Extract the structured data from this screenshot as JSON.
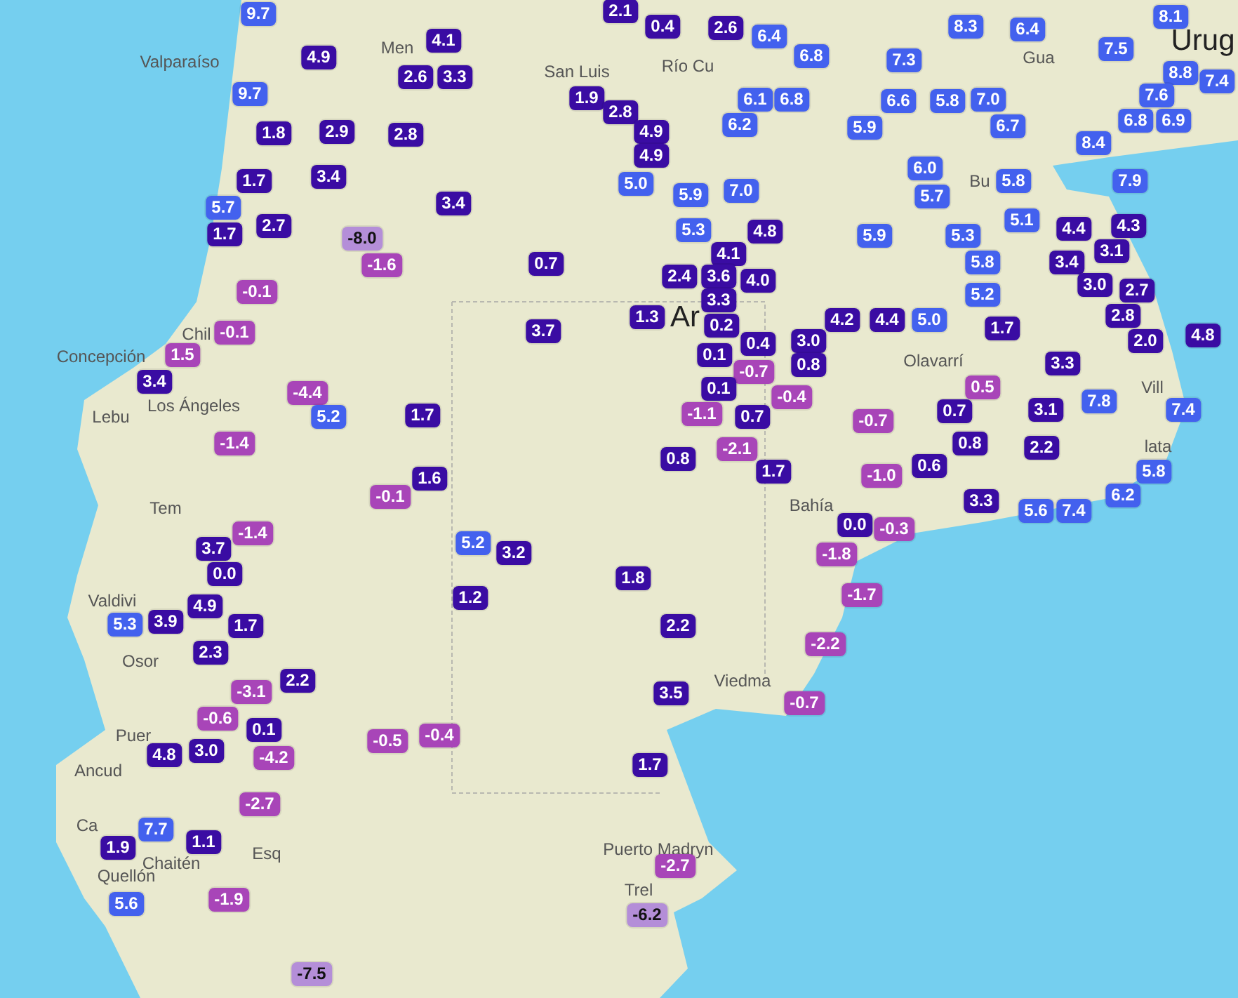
{
  "map": {
    "place_labels": [
      {
        "text": "Valparaíso",
        "kind": "city"
      },
      {
        "text": "Men",
        "kind": "city"
      },
      {
        "text": "San Luis",
        "kind": "city"
      },
      {
        "text": "Río Cu",
        "kind": "city"
      },
      {
        "text": "Gua",
        "kind": "city"
      },
      {
        "text": "Urug",
        "kind": "country"
      },
      {
        "text": "Chil",
        "kind": "city"
      },
      {
        "text": "Concepción",
        "kind": "city"
      },
      {
        "text": "Los Ángeles",
        "kind": "city"
      },
      {
        "text": "Lebu",
        "kind": "city"
      },
      {
        "text": "Ar",
        "kind": "country"
      },
      {
        "text": "Bu",
        "kind": "city"
      },
      {
        "text": "Olavarrí",
        "kind": "city"
      },
      {
        "text": "Vill",
        "kind": "city"
      },
      {
        "text": "lata",
        "kind": "city"
      },
      {
        "text": "Tem",
        "kind": "city"
      },
      {
        "text": "Bahía",
        "kind": "city"
      },
      {
        "text": "Valdivi",
        "kind": "city"
      },
      {
        "text": "Osor",
        "kind": "city"
      },
      {
        "text": "Viedma",
        "kind": "city"
      },
      {
        "text": "Puer",
        "kind": "city"
      },
      {
        "text": "Ancud",
        "kind": "city"
      },
      {
        "text": "Ca",
        "kind": "city"
      },
      {
        "text": "Esq",
        "kind": "city"
      },
      {
        "text": "Puerto Madryn",
        "kind": "city"
      },
      {
        "text": "Chaitén",
        "kind": "city"
      },
      {
        "text": "Quellón",
        "kind": "city"
      },
      {
        "text": "Trel",
        "kind": "city"
      }
    ],
    "markers": [
      {
        "value": "9.7",
        "color": "#4361ee"
      },
      {
        "value": "4.9",
        "color": "#3a0ca3"
      },
      {
        "value": "9.7",
        "color": "#4361ee"
      },
      {
        "value": "1.8",
        "color": "#3a0ca3"
      },
      {
        "value": "2.9",
        "color": "#3a0ca3"
      },
      {
        "value": "1.7",
        "color": "#3a0ca3"
      },
      {
        "value": "3.4",
        "color": "#3a0ca3"
      },
      {
        "value": "5.7",
        "color": "#4361ee"
      },
      {
        "value": "1.7",
        "color": "#3a0ca3"
      },
      {
        "value": "2.7",
        "color": "#3a0ca3"
      },
      {
        "value": "-8.0",
        "color": "#b48ed8"
      },
      {
        "value": "-1.6",
        "color": "#a845b8"
      },
      {
        "value": "-0.1",
        "color": "#a845b8"
      },
      {
        "value": "-0.1",
        "color": "#a845b8"
      },
      {
        "value": "1.5",
        "color": "#a845b8"
      },
      {
        "value": "3.4",
        "color": "#3a0ca3"
      },
      {
        "value": "-4.4",
        "color": "#a845b8"
      },
      {
        "value": "5.2",
        "color": "#4361ee"
      },
      {
        "value": "-1.4",
        "color": "#a845b8"
      },
      {
        "value": "1.7",
        "color": "#3a0ca3"
      },
      {
        "value": "-0.1",
        "color": "#a845b8"
      },
      {
        "value": "1.6",
        "color": "#3a0ca3"
      },
      {
        "value": "-1.4",
        "color": "#a845b8"
      },
      {
        "value": "3.7",
        "color": "#3a0ca3"
      },
      {
        "value": "0.0",
        "color": "#3a0ca3"
      },
      {
        "value": "4.9",
        "color": "#3a0ca3"
      },
      {
        "value": "5.3",
        "color": "#4361ee"
      },
      {
        "value": "3.9",
        "color": "#3a0ca3"
      },
      {
        "value": "1.7",
        "color": "#3a0ca3"
      },
      {
        "value": "2.3",
        "color": "#3a0ca3"
      },
      {
        "value": "2.2",
        "color": "#3a0ca3"
      },
      {
        "value": "-3.1",
        "color": "#a845b8"
      },
      {
        "value": "-0.6",
        "color": "#a845b8"
      },
      {
        "value": "0.1",
        "color": "#3a0ca3"
      },
      {
        "value": "-0.5",
        "color": "#a845b8"
      },
      {
        "value": "-0.4",
        "color": "#a845b8"
      },
      {
        "value": "4.8",
        "color": "#3a0ca3"
      },
      {
        "value": "3.0",
        "color": "#3a0ca3"
      },
      {
        "value": "-4.2",
        "color": "#a845b8"
      },
      {
        "value": "-2.7",
        "color": "#a845b8"
      },
      {
        "value": "7.7",
        "color": "#4361ee"
      },
      {
        "value": "1.1",
        "color": "#3a0ca3"
      },
      {
        "value": "1.9",
        "color": "#3a0ca3"
      },
      {
        "value": "5.6",
        "color": "#4361ee"
      },
      {
        "value": "-1.9",
        "color": "#a845b8"
      },
      {
        "value": "-7.5",
        "color": "#b48ed8"
      },
      {
        "value": "2.1",
        "color": "#3a0ca3"
      },
      {
        "value": "0.4",
        "color": "#3a0ca3"
      },
      {
        "value": "2.6",
        "color": "#3a0ca3"
      },
      {
        "value": "4.1",
        "color": "#3a0ca3"
      },
      {
        "value": "2.6",
        "color": "#3a0ca3"
      },
      {
        "value": "3.3",
        "color": "#3a0ca3"
      },
      {
        "value": "2.8",
        "color": "#3a0ca3"
      },
      {
        "value": "1.9",
        "color": "#3a0ca3"
      },
      {
        "value": "2.8",
        "color": "#3a0ca3"
      },
      {
        "value": "4.9",
        "color": "#3a0ca3"
      },
      {
        "value": "4.9",
        "color": "#3a0ca3"
      },
      {
        "value": "5.0",
        "color": "#4361ee"
      },
      {
        "value": "3.4",
        "color": "#3a0ca3"
      },
      {
        "value": "0.7",
        "color": "#3a0ca3"
      },
      {
        "value": "3.7",
        "color": "#3a0ca3"
      },
      {
        "value": "1.3",
        "color": "#3a0ca3"
      },
      {
        "value": "6.4",
        "color": "#4361ee"
      },
      {
        "value": "6.8",
        "color": "#4361ee"
      },
      {
        "value": "6.1",
        "color": "#4361ee"
      },
      {
        "value": "6.8",
        "color": "#4361ee"
      },
      {
        "value": "6.2",
        "color": "#4361ee"
      },
      {
        "value": "5.9",
        "color": "#4361ee"
      },
      {
        "value": "7.0",
        "color": "#4361ee"
      },
      {
        "value": "5.3",
        "color": "#4361ee"
      },
      {
        "value": "4.8",
        "color": "#3a0ca3"
      },
      {
        "value": "4.1",
        "color": "#3a0ca3"
      },
      {
        "value": "2.4",
        "color": "#3a0ca3"
      },
      {
        "value": "3.6",
        "color": "#3a0ca3"
      },
      {
        "value": "4.0",
        "color": "#3a0ca3"
      },
      {
        "value": "3.3",
        "color": "#3a0ca3"
      },
      {
        "value": "0.2",
        "color": "#3a0ca3"
      },
      {
        "value": "0.1",
        "color": "#3a0ca3"
      },
      {
        "value": "0.4",
        "color": "#3a0ca3"
      },
      {
        "value": "3.0",
        "color": "#3a0ca3"
      },
      {
        "value": "0.8",
        "color": "#3a0ca3"
      },
      {
        "value": "-0.7",
        "color": "#a845b8"
      },
      {
        "value": "0.1",
        "color": "#3a0ca3"
      },
      {
        "value": "-0.4",
        "color": "#a845b8"
      },
      {
        "value": "-1.1",
        "color": "#a845b8"
      },
      {
        "value": "0.7",
        "color": "#3a0ca3"
      },
      {
        "value": "-2.1",
        "color": "#a845b8"
      },
      {
        "value": "0.8",
        "color": "#3a0ca3"
      },
      {
        "value": "1.7",
        "color": "#3a0ca3"
      },
      {
        "value": "5.2",
        "color": "#4361ee"
      },
      {
        "value": "3.2",
        "color": "#3a0ca3"
      },
      {
        "value": "1.8",
        "color": "#3a0ca3"
      },
      {
        "value": "2.2",
        "color": "#3a0ca3"
      },
      {
        "value": "1.2",
        "color": "#3a0ca3"
      },
      {
        "value": "3.5",
        "color": "#3a0ca3"
      },
      {
        "value": "1.7",
        "color": "#3a0ca3"
      },
      {
        "value": "-2.7",
        "color": "#a845b8"
      },
      {
        "value": "-6.2",
        "color": "#b48ed8"
      },
      {
        "value": "-0.7",
        "color": "#a845b8"
      },
      {
        "value": "-2.2",
        "color": "#a845b8"
      },
      {
        "value": "-1.7",
        "color": "#a845b8"
      },
      {
        "value": "-1.8",
        "color": "#a845b8"
      },
      {
        "value": "0.0",
        "color": "#3a0ca3"
      },
      {
        "value": "-0.3",
        "color": "#a845b8"
      },
      {
        "value": "8.3",
        "color": "#4361ee"
      },
      {
        "value": "6.4",
        "color": "#4361ee"
      },
      {
        "value": "8.1",
        "color": "#4361ee"
      },
      {
        "value": "7.3",
        "color": "#4361ee"
      },
      {
        "value": "7.5",
        "color": "#4361ee"
      },
      {
        "value": "8.8",
        "color": "#4361ee"
      },
      {
        "value": "7.4",
        "color": "#4361ee"
      },
      {
        "value": "6.6",
        "color": "#4361ee"
      },
      {
        "value": "5.8",
        "color": "#4361ee"
      },
      {
        "value": "7.0",
        "color": "#4361ee"
      },
      {
        "value": "7.6",
        "color": "#4361ee"
      },
      {
        "value": "6.8",
        "color": "#4361ee"
      },
      {
        "value": "6.9",
        "color": "#4361ee"
      },
      {
        "value": "6.7",
        "color": "#4361ee"
      },
      {
        "value": "8.4",
        "color": "#4361ee"
      },
      {
        "value": "5.9",
        "color": "#4361ee"
      },
      {
        "value": "6.0",
        "color": "#4361ee"
      },
      {
        "value": "5.7",
        "color": "#4361ee"
      },
      {
        "value": "5.8",
        "color": "#4361ee"
      },
      {
        "value": "7.9",
        "color": "#4361ee"
      },
      {
        "value": "5.1",
        "color": "#4361ee"
      },
      {
        "value": "4.4",
        "color": "#3a0ca3"
      },
      {
        "value": "4.3",
        "color": "#3a0ca3"
      },
      {
        "value": "3.1",
        "color": "#3a0ca3"
      },
      {
        "value": "5.9",
        "color": "#4361ee"
      },
      {
        "value": "5.3",
        "color": "#4361ee"
      },
      {
        "value": "5.8",
        "color": "#4361ee"
      },
      {
        "value": "3.4",
        "color": "#3a0ca3"
      },
      {
        "value": "5.2",
        "color": "#4361ee"
      },
      {
        "value": "3.0",
        "color": "#3a0ca3"
      },
      {
        "value": "2.7",
        "color": "#3a0ca3"
      },
      {
        "value": "4.2",
        "color": "#3a0ca3"
      },
      {
        "value": "4.4",
        "color": "#3a0ca3"
      },
      {
        "value": "5.0",
        "color": "#4361ee"
      },
      {
        "value": "1.7",
        "color": "#3a0ca3"
      },
      {
        "value": "2.8",
        "color": "#3a0ca3"
      },
      {
        "value": "2.0",
        "color": "#3a0ca3"
      },
      {
        "value": "4.8",
        "color": "#3a0ca3"
      },
      {
        "value": "3.3",
        "color": "#3a0ca3"
      },
      {
        "value": "0.5",
        "color": "#a845b8"
      },
      {
        "value": "-0.7",
        "color": "#a845b8"
      },
      {
        "value": "0.7",
        "color": "#3a0ca3"
      },
      {
        "value": "3.1",
        "color": "#3a0ca3"
      },
      {
        "value": "7.8",
        "color": "#4361ee"
      },
      {
        "value": "7.4",
        "color": "#4361ee"
      },
      {
        "value": "0.8",
        "color": "#3a0ca3"
      },
      {
        "value": "0.6",
        "color": "#3a0ca3"
      },
      {
        "value": "2.2",
        "color": "#3a0ca3"
      },
      {
        "value": "-1.0",
        "color": "#a845b8"
      },
      {
        "value": "5.8",
        "color": "#4361ee"
      },
      {
        "value": "6.2",
        "color": "#4361ee"
      },
      {
        "value": "3.3",
        "color": "#3a0ca3"
      },
      {
        "value": "5.6",
        "color": "#4361ee"
      },
      {
        "value": "7.4",
        "color": "#4361ee"
      }
    ]
  }
}
